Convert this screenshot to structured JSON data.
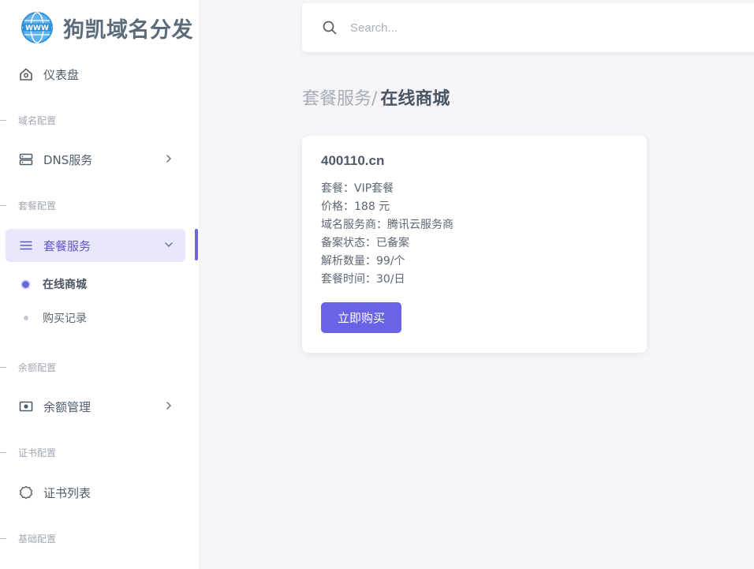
{
  "brand": {
    "title": "狗凯域名分发",
    "logo_icon": "www-globe-icon"
  },
  "search": {
    "placeholder": "Search..."
  },
  "sidebar": {
    "dashboard": "仪表盘",
    "sections": {
      "domain": "域名配置",
      "plan": "套餐配置",
      "balance": "余额配置",
      "cert": "证书配置",
      "basic": "基础配置"
    },
    "dns": "DNS服务",
    "plan_service": "套餐服务",
    "sub_items": {
      "online_store": "在线商城",
      "purchase_records": "购买记录"
    },
    "balance_mgmt": "余额管理",
    "cert_list": "证书列表"
  },
  "breadcrumb": {
    "parent": "套餐服务/",
    "current": "在线商城"
  },
  "product": {
    "domain": "400110.cn",
    "rows": {
      "plan": "套餐：VIP套餐",
      "price": "价格：188 元",
      "provider": "域名服务商：腾讯云服务商",
      "icp": "备案状态：已备案",
      "records": "解析数量：99/个",
      "duration": "套餐时间：30/日"
    },
    "buy_label": "立即购买"
  },
  "colors": {
    "accent": "#6a63e5",
    "active_bg": "#e8e7fb"
  }
}
